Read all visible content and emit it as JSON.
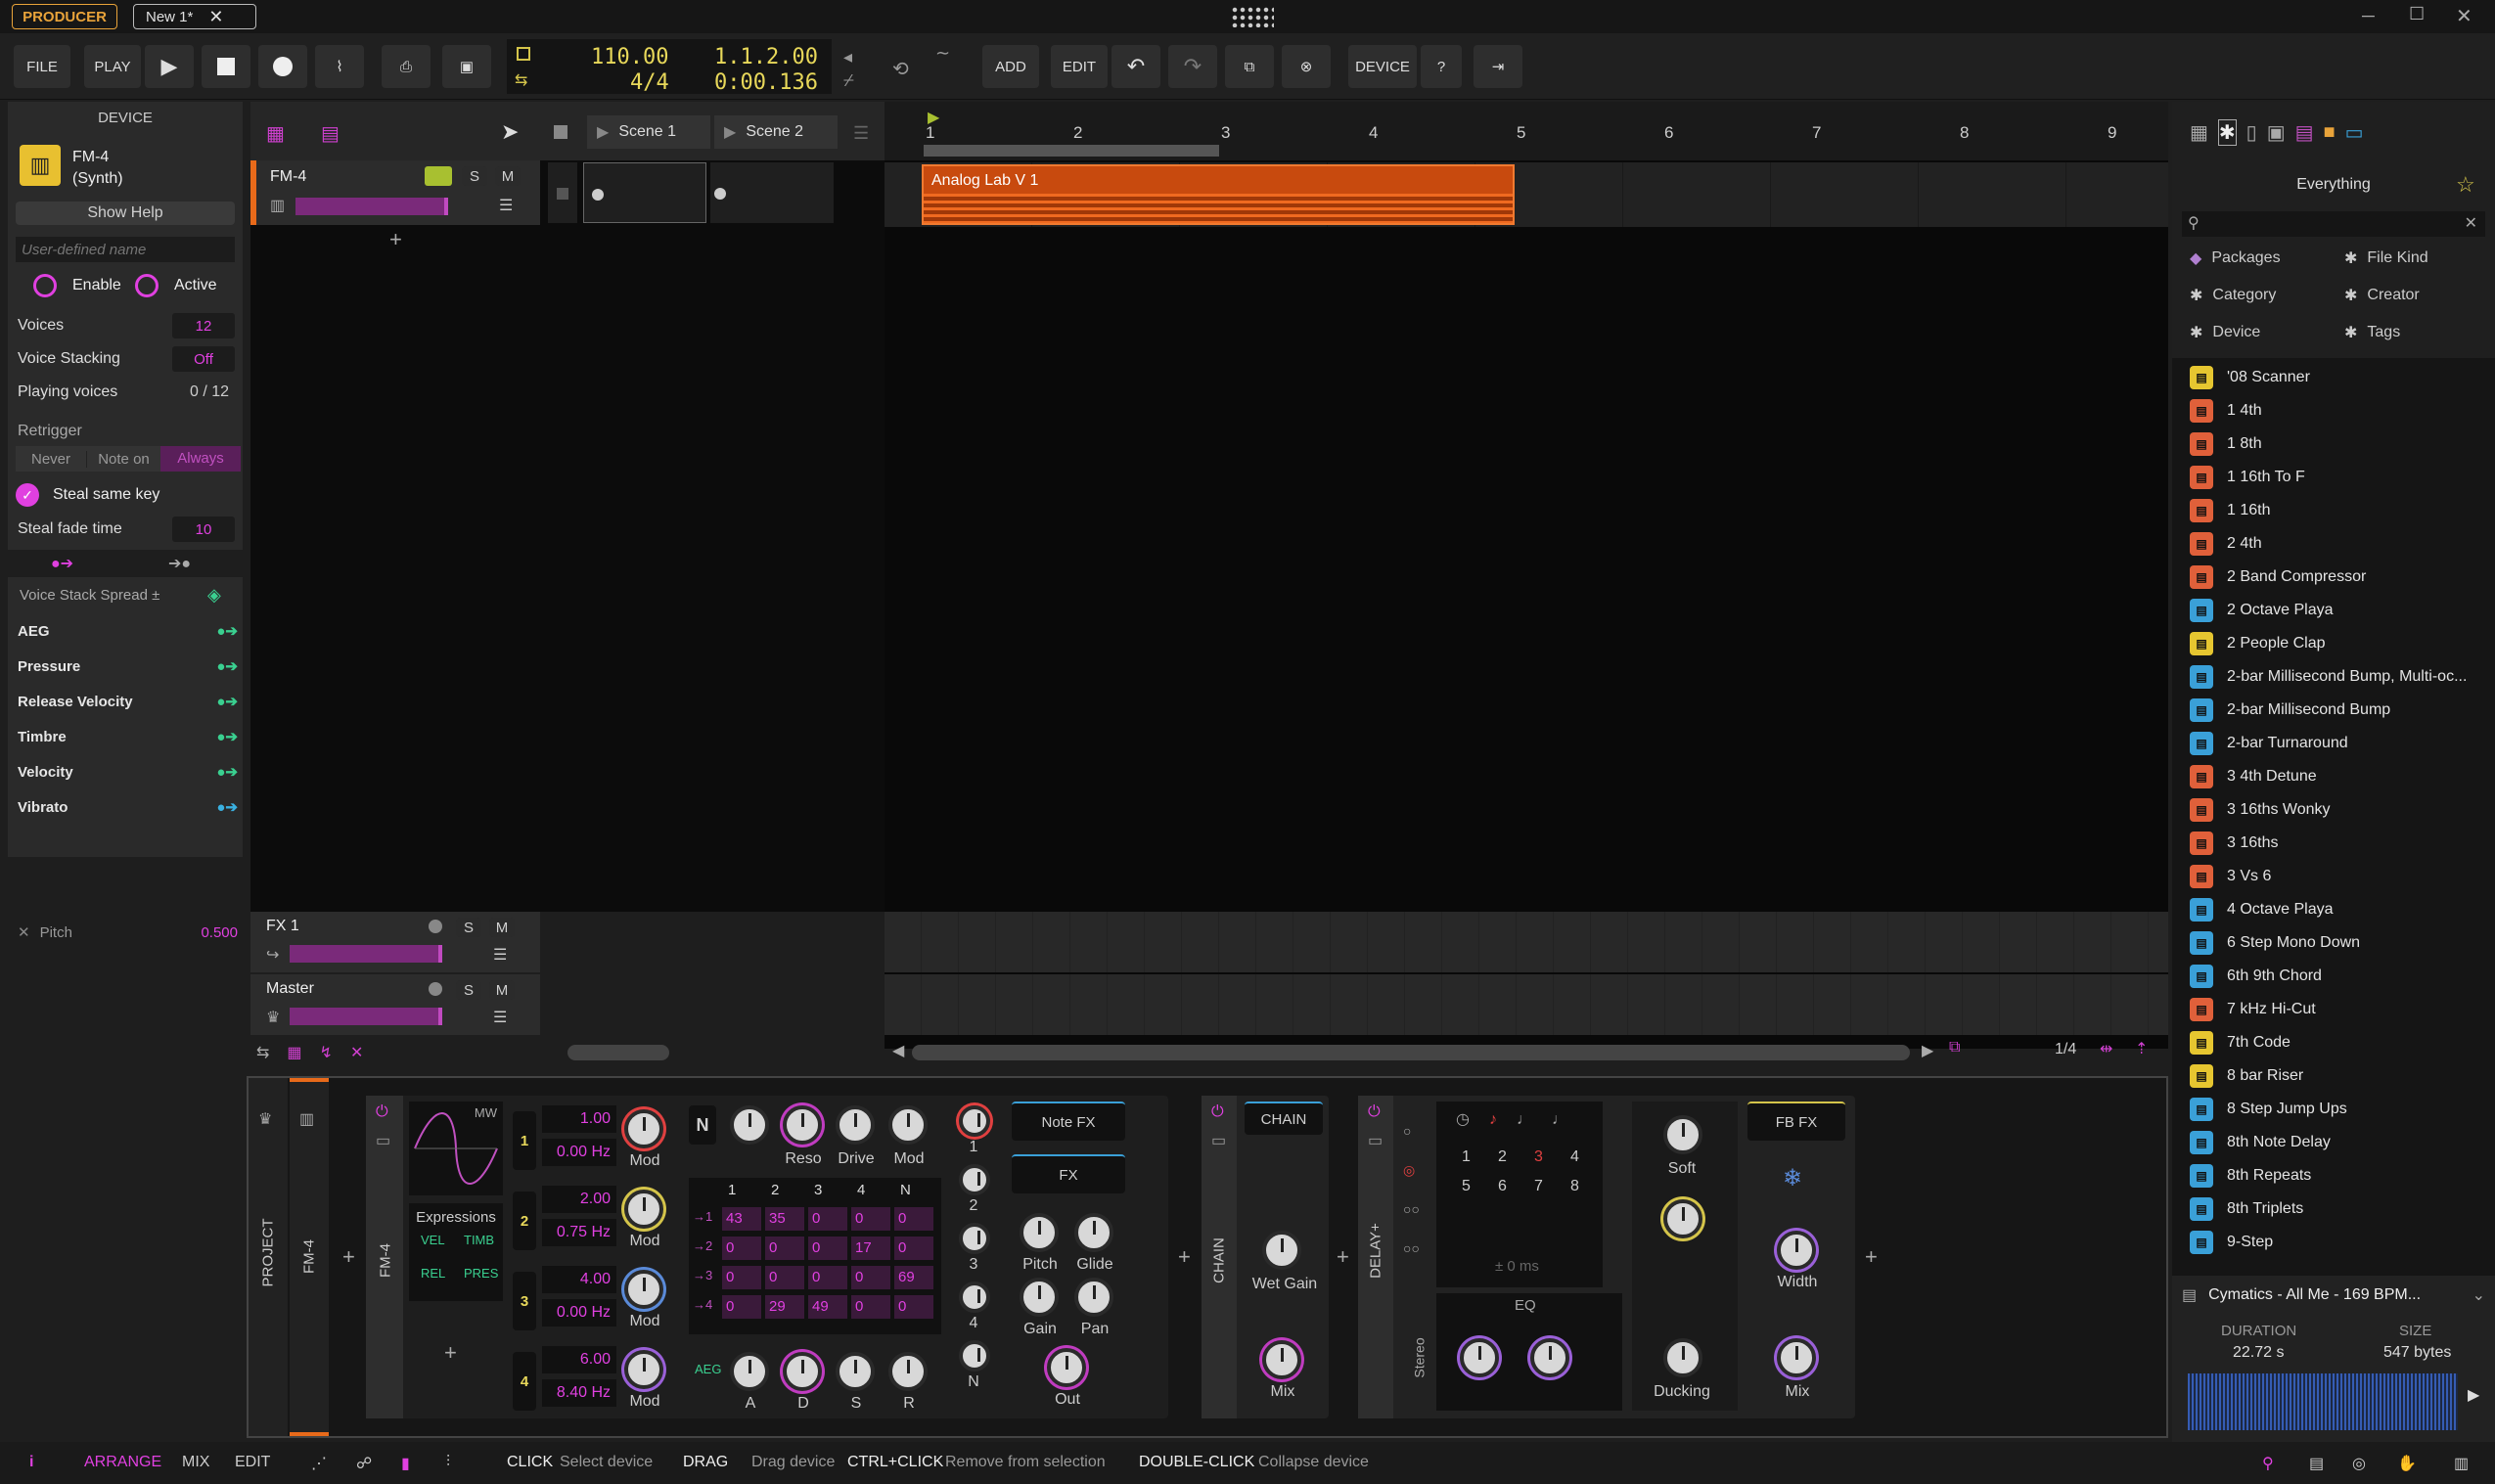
{
  "titlebar": {
    "mode": "PRODUCER",
    "doc_tab": "New 1*"
  },
  "transport": {
    "file": "FILE",
    "play": "PLAY",
    "tempo": "110.00",
    "timesig": "4/4",
    "position": "1.1.2.00",
    "time": "0:00.136",
    "add": "ADD",
    "edit": "EDIT",
    "device": "DEVICE"
  },
  "device_panel": {
    "header": "DEVICE",
    "name": "FM-4",
    "type": "(Synth)",
    "show_help": "Show Help",
    "name_placeholder": "User-defined name",
    "enable": "Enable",
    "active": "Active",
    "voices_label": "Voices",
    "voices_value": "12",
    "stacking_label": "Voice Stacking",
    "stacking_value": "Off",
    "playing_label": "Playing voices",
    "playing_value": "0 / 12",
    "retrigger_label": "Retrigger",
    "retrigger_options": [
      "Never",
      "Note on",
      "Always"
    ],
    "steal_key": "Steal same key",
    "steal_fade_label": "Steal fade time",
    "steal_fade_value": "10",
    "spread_label": "Voice Stack Spread ±",
    "mods": [
      "AEG",
      "Pressure",
      "Release Velocity",
      "Timbre",
      "Velocity",
      "Vibrato"
    ],
    "pitch_label": "Pitch",
    "pitch_value": "0.500"
  },
  "arranger": {
    "scenes": [
      "Scene 1",
      "Scene 2"
    ],
    "ruler": [
      "1",
      "2",
      "3",
      "4",
      "5",
      "6",
      "7",
      "8",
      "9"
    ],
    "tracks": [
      {
        "name": "FM-4",
        "s": "S",
        "m": "M"
      },
      {
        "name": "FX 1",
        "s": "S",
        "m": "M"
      },
      {
        "name": "Master",
        "s": "S",
        "m": "M"
      }
    ],
    "clip_name": "Analog Lab V 1",
    "zoom": "1/4"
  },
  "browser": {
    "title": "Everything",
    "filters": [
      "Packages",
      "File Kind",
      "Category",
      "Creator",
      "Device",
      "Tags"
    ],
    "items": [
      {
        "label": "'08 Scanner",
        "color": "#e6c630"
      },
      {
        "label": "1 4th",
        "color": "#e0603a"
      },
      {
        "label": "1 8th",
        "color": "#e0603a"
      },
      {
        "label": "1 16th To F",
        "color": "#e0603a"
      },
      {
        "label": "1 16th",
        "color": "#e0603a"
      },
      {
        "label": "2 4th",
        "color": "#e0603a"
      },
      {
        "label": "2 Band Compressor",
        "color": "#e0603a"
      },
      {
        "label": "2 Octave Playa",
        "color": "#3aa0d8"
      },
      {
        "label": "2 People Clap",
        "color": "#e6c630"
      },
      {
        "label": "2-bar Millisecond Bump, Multi-oc...",
        "color": "#3aa0d8"
      },
      {
        "label": "2-bar Millisecond Bump",
        "color": "#3aa0d8"
      },
      {
        "label": "2-bar Turnaround",
        "color": "#3aa0d8"
      },
      {
        "label": "3 4th Detune",
        "color": "#e0603a"
      },
      {
        "label": "3 16ths Wonky",
        "color": "#e0603a"
      },
      {
        "label": "3 16ths",
        "color": "#e0603a"
      },
      {
        "label": "3 Vs 6",
        "color": "#e0603a"
      },
      {
        "label": "4 Octave Playa",
        "color": "#3aa0d8"
      },
      {
        "label": "6 Step Mono Down",
        "color": "#3aa0d8"
      },
      {
        "label": "6th 9th Chord",
        "color": "#3aa0d8"
      },
      {
        "label": "7 kHz Hi-Cut",
        "color": "#e0603a"
      },
      {
        "label": "7th Code",
        "color": "#e6c630"
      },
      {
        "label": "8 bar Riser",
        "color": "#e6c630"
      },
      {
        "label": "8 Step Jump Ups",
        "color": "#3aa0d8"
      },
      {
        "label": "8th Note Delay",
        "color": "#3aa0d8"
      },
      {
        "label": "8th Repeats",
        "color": "#3aa0d8"
      },
      {
        "label": "8th Triplets",
        "color": "#3aa0d8"
      },
      {
        "label": "9-Step",
        "color": "#3aa0d8"
      }
    ],
    "preview_name": "Cymatics - All Me - 169 BPM...",
    "duration_label": "DURATION",
    "duration_value": "22.72 s",
    "size_label": "SIZE",
    "size_value": "547 bytes"
  },
  "devices": {
    "project_label": "PROJECT",
    "track_label": "FM-4",
    "device_label": "FM-4",
    "mw": "MW",
    "expressions": "Expressions",
    "expr_tags": [
      "VEL",
      "TIMB",
      "REL",
      "PRES"
    ],
    "ops": [
      {
        "num": "1",
        "ratio": "1.00",
        "hz": "0.00 Hz"
      },
      {
        "num": "2",
        "ratio": "2.00",
        "hz": "0.75 Hz"
      },
      {
        "num": "3",
        "ratio": "4.00",
        "hz": "0.00 Hz"
      },
      {
        "num": "4",
        "ratio": "6.00",
        "hz": "8.40 Hz"
      }
    ],
    "mod_label": "Mod",
    "n_label": "N",
    "top_knobs": [
      "Reso",
      "Drive",
      "Mod"
    ],
    "matrix_header": [
      "1",
      "2",
      "3",
      "4",
      "N"
    ],
    "matrix_rows": [
      {
        "row": "→1",
        "vals": [
          "43",
          "35",
          "0",
          "0",
          "0"
        ]
      },
      {
        "row": "→2",
        "vals": [
          "0",
          "0",
          "0",
          "17",
          "0"
        ]
      },
      {
        "row": "→3",
        "vals": [
          "0",
          "0",
          "0",
          "0",
          "69"
        ]
      },
      {
        "row": "→4",
        "vals": [
          "0",
          "29",
          "49",
          "0",
          "0"
        ]
      }
    ],
    "env_knobs": [
      "A",
      "D",
      "S",
      "R"
    ],
    "aeg": "AEG",
    "op_col": [
      "1",
      "2",
      "3",
      "4",
      "N"
    ],
    "note_fx": "Note FX",
    "fx": "FX",
    "pitch": "Pitch",
    "glide": "Glide",
    "gain": "Gain",
    "pan": "Pan",
    "out": "Out",
    "chain_title": "CHAIN",
    "chain_side": "CHAIN",
    "wet_gain": "Wet Gain",
    "mix": "Mix",
    "delay_side": "DELAY+",
    "delay_stereo": "Stereo",
    "delay_grid": [
      "1",
      "2",
      "3",
      "4",
      "5",
      "6",
      "7",
      "8"
    ],
    "delay_ms": "± 0 ms",
    "eq": "EQ",
    "soft": "Soft",
    "ducking": "Ducking",
    "fbfx": "FB FX",
    "width": "Width"
  },
  "footer": {
    "tabs": [
      "ARRANGE",
      "MIX",
      "EDIT"
    ],
    "hints": [
      {
        "key": "CLICK",
        "desc": "Select device"
      },
      {
        "key": "DRAG",
        "desc": "Drag device"
      },
      {
        "key": "CTRL+CLICK",
        "desc": "Remove from selection"
      },
      {
        "key": "DOUBLE-CLICK",
        "desc": "Collapse device"
      }
    ]
  }
}
